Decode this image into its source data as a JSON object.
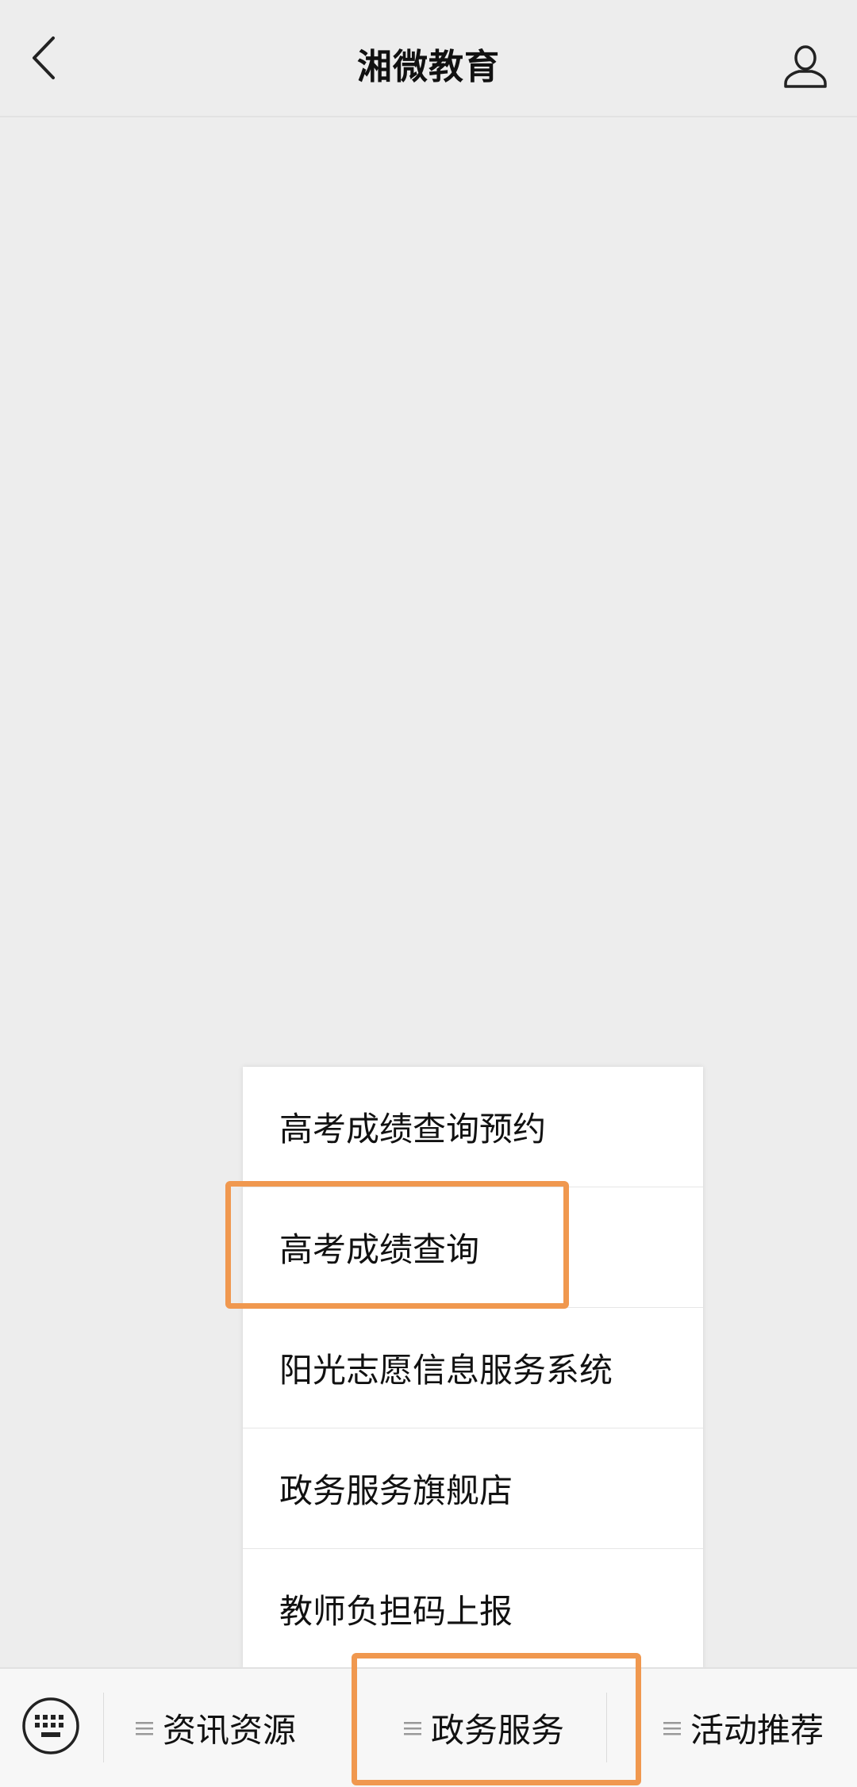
{
  "header": {
    "title": "湘微教育",
    "back_icon": "back-chevron-icon",
    "profile_icon": "user-profile-icon"
  },
  "popup_menu": {
    "items": [
      {
        "label": "高考成绩查询预约"
      },
      {
        "label": "高考成绩查询"
      },
      {
        "label": "阳光志愿信息服务系统"
      },
      {
        "label": "政务服务旗舰店"
      },
      {
        "label": "教师负担码上报"
      }
    ],
    "highlighted_item": "高考成绩查询"
  },
  "bottom_bar": {
    "keyboard_icon": "keyboard-icon",
    "tabs": [
      {
        "label": "资讯资源"
      },
      {
        "label": "政务服务"
      },
      {
        "label": "活动推荐"
      }
    ],
    "highlighted_tab": "政务服务"
  },
  "colors": {
    "background": "#ededed",
    "highlight": "#f0984f",
    "popup_bg": "#ffffff",
    "bottom_bar_bg": "#f7f7f7"
  }
}
